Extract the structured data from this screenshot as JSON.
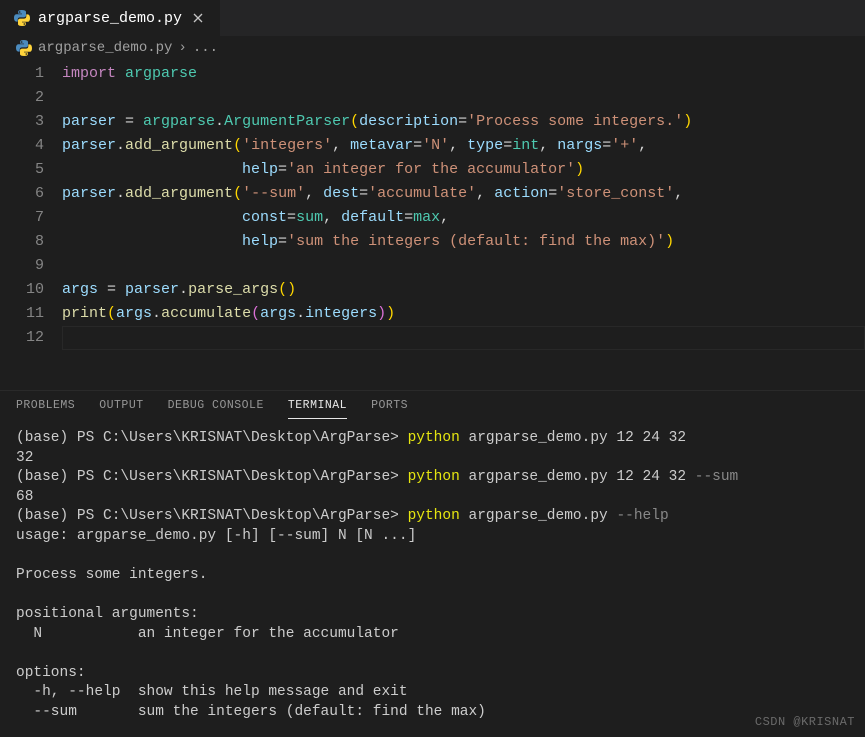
{
  "tab": {
    "filename": "argparse_demo.py"
  },
  "breadcrumb": {
    "file": "argparse_demo.py",
    "sep": "›",
    "more": "..."
  },
  "lines": [
    "1",
    "2",
    "3",
    "4",
    "5",
    "6",
    "7",
    "8",
    "9",
    "10",
    "11",
    "12"
  ],
  "code": {
    "l1": {
      "kw": "import",
      "sp": " ",
      "mod": "argparse"
    },
    "l3": {
      "var": "parser",
      "eq": " = ",
      "mod": "argparse",
      "dot": ".",
      "cls": "ArgumentParser",
      "op1": "(",
      "arg": "description",
      "as": "=",
      "str": "'Process some integers.'",
      "op2": ")"
    },
    "l4": {
      "var": "parser",
      "dot": ".",
      "fn": "add_argument",
      "op1": "(",
      "str1": "'integers'",
      "c1": ", ",
      "arg1": "metavar",
      "as1": "=",
      "str2": "'N'",
      "c2": ", ",
      "arg2": "type",
      "as2": "=",
      "bi": "int",
      "c3": ", ",
      "arg3": "nargs",
      "as3": "=",
      "str3": "'+'",
      "c4": ","
    },
    "l5": {
      "indent": "                    ",
      "arg": "help",
      "as": "=",
      "str": "'an integer for the accumulator'",
      "op": ")"
    },
    "l6": {
      "var": "parser",
      "dot": ".",
      "fn": "add_argument",
      "op1": "(",
      "str1": "'--sum'",
      "c1": ", ",
      "arg1": "dest",
      "as1": "=",
      "str2": "'accumulate'",
      "c2": ", ",
      "arg2": "action",
      "as2": "=",
      "str3": "'store_const'",
      "c3": ","
    },
    "l7": {
      "indent": "                    ",
      "arg1": "const",
      "as1": "=",
      "bi1": "sum",
      "c1": ", ",
      "arg2": "default",
      "as2": "=",
      "bi2": "max",
      "c2": ","
    },
    "l8": {
      "indent": "                    ",
      "arg": "help",
      "as": "=",
      "str": "'sum the integers (default: find the max)'",
      "op": ")"
    },
    "l10": {
      "var1": "args",
      "eq": " = ",
      "var2": "parser",
      "dot": ".",
      "fn": "parse_args",
      "op1": "(",
      "op2": ")"
    },
    "l11": {
      "fn": "print",
      "op1": "(",
      "var1": "args",
      "dot1": ".",
      "fn2": "accumulate",
      "op2": "(",
      "var2": "args",
      "dot2": ".",
      "attr": "integers",
      "op3": ")",
      "op4": ")"
    }
  },
  "panel": {
    "tabs": {
      "problems": "PROBLEMS",
      "output": "OUTPUT",
      "debug": "DEBUG CONSOLE",
      "terminal": "TERMINAL",
      "ports": "PORTS"
    }
  },
  "terminal": {
    "prompt": "(base) PS C:\\Users\\KRISNAT\\Desktop\\ArgParse> ",
    "cmd_py": "python",
    "cmd1_args": " argparse_demo.py 12 24 32",
    "out1": "32",
    "cmd2_args": " argparse_demo.py 12 24 32 ",
    "cmd2_flag": "--sum",
    "out2": "68",
    "cmd3_args": " argparse_demo.py ",
    "cmd3_flag": "--help",
    "help1": "usage: argparse_demo.py [-h] [--sum] N [N ...]",
    "help2": "Process some integers.",
    "help3": "positional arguments:",
    "help4": "  N           an integer for the accumulator",
    "help5": "options:",
    "help6": "  -h, --help  show this help message and exit",
    "help7": "  --sum       sum the integers (default: find the max)"
  },
  "watermark": "CSDN @KRISNAT"
}
